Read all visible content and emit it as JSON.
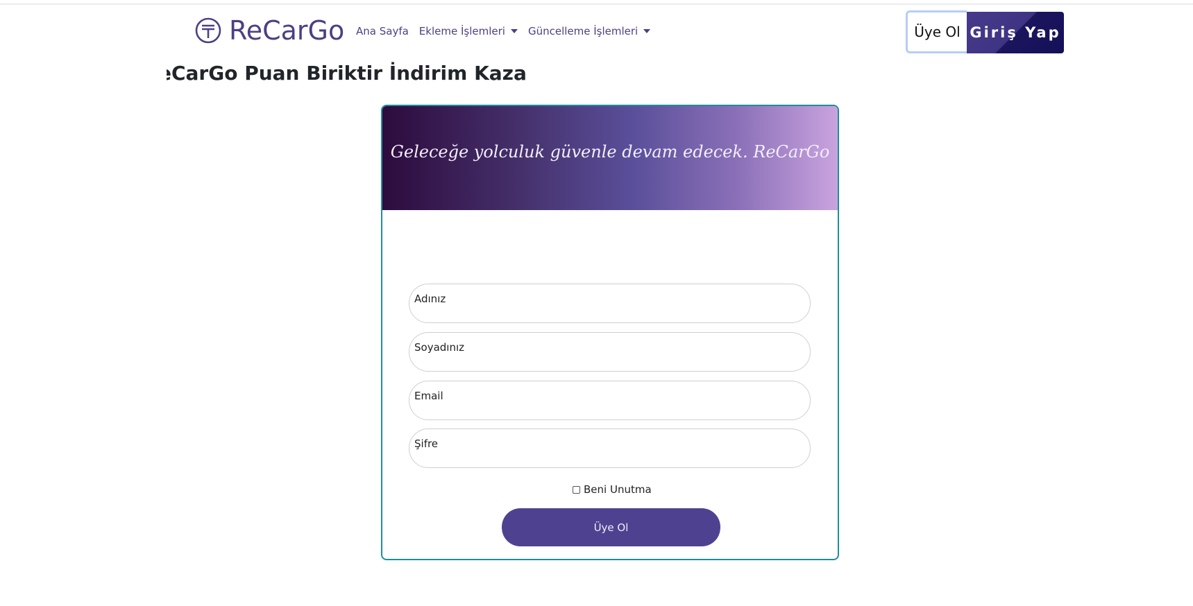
{
  "brand": {
    "name": "ReCarGo",
    "icon": "currency-circle-icon",
    "color": "#4d3f82"
  },
  "nav": {
    "items": [
      {
        "label": "Ana Sayfa",
        "dropdown": false
      },
      {
        "label": "Ekleme İşlemleri",
        "dropdown": true
      },
      {
        "label": "Güncelleme İşlemleri",
        "dropdown": true
      }
    ]
  },
  "auth": {
    "register_label": "Üye Ol",
    "login_label": "Giriş Yap"
  },
  "headline": "eCarGo Puan Biriktir İndirim Kazan!",
  "card": {
    "tagline": "Geleceğe yolculuk güvenle devam edecek. ReCarGo",
    "fields": [
      {
        "label": "Adınız",
        "value": ""
      },
      {
        "label": "Soyadınız",
        "value": ""
      },
      {
        "label": "Email",
        "value": ""
      },
      {
        "label": "Şifre",
        "value": ""
      }
    ],
    "remember_label": "Beni Unutma",
    "remember_checked": false,
    "submit_label": "Üye Ol",
    "border_color": "#1c8e9e",
    "button_color": "#4e4290"
  }
}
